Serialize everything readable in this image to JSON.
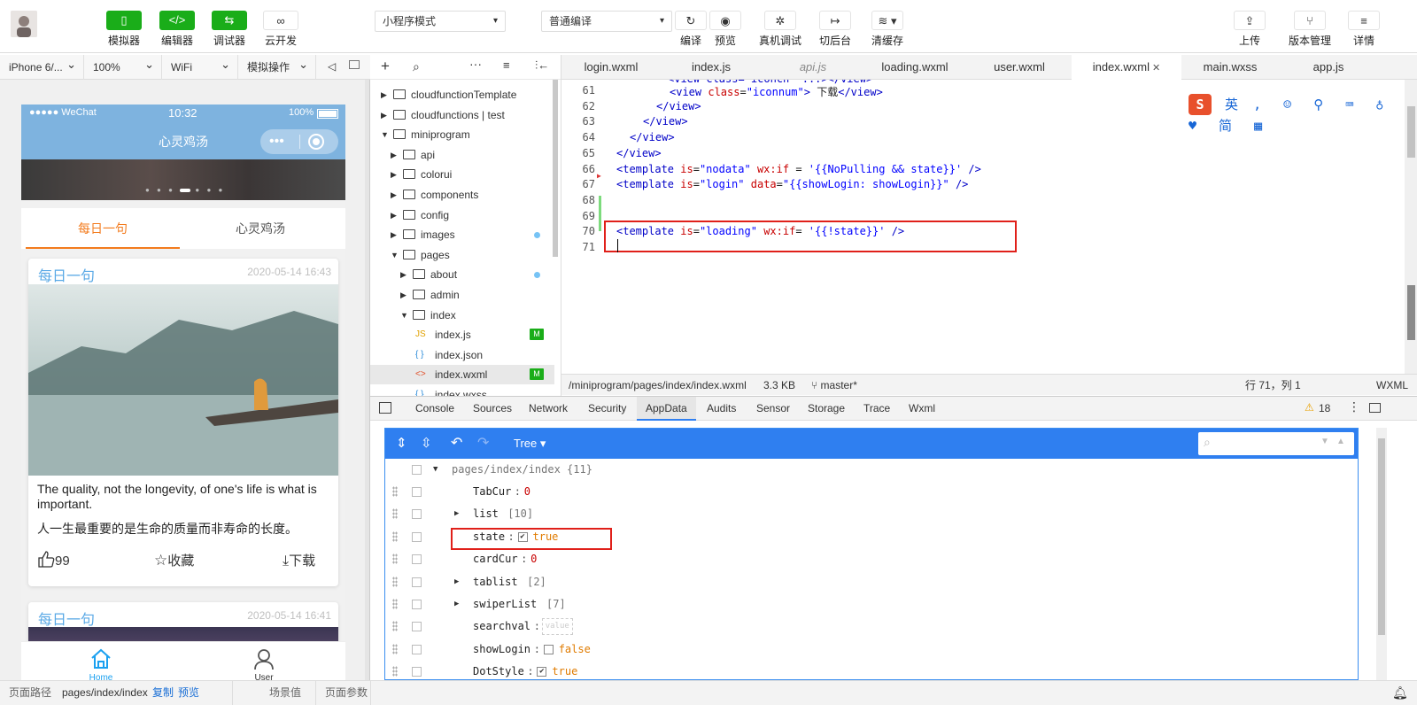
{
  "toolbar": {
    "left_buttons": [
      {
        "label": "模拟器",
        "icon": "phone-icon"
      },
      {
        "label": "编辑器",
        "icon": "code-icon"
      },
      {
        "label": "调试器",
        "icon": "debug-icon"
      },
      {
        "label": "云开发",
        "icon": "cloud-link-icon"
      }
    ],
    "mode_select": "小程序模式",
    "compile_select": "普通编译",
    "mid_buttons": [
      {
        "label": "编译",
        "icon": "refresh-icon"
      },
      {
        "label": "预览",
        "icon": "eye-icon"
      },
      {
        "label": "真机调试",
        "icon": "bug-icon"
      },
      {
        "label": "切后台",
        "icon": "switch-icon"
      },
      {
        "label": "清缓存",
        "icon": "layers-icon"
      }
    ],
    "right_buttons": [
      {
        "label": "上传",
        "icon": "upload-icon"
      },
      {
        "label": "版本管理",
        "icon": "branch-icon"
      },
      {
        "label": "详情",
        "icon": "menu-icon"
      }
    ]
  },
  "simulator_bar": {
    "device": "iPhone 6/...",
    "zoom": "100%",
    "network": "WiFi",
    "operation": "模拟操作"
  },
  "phone": {
    "carrier": "●●●●● WeChat",
    "time": "10:32",
    "battery": "100%",
    "nav_title": "心灵鸡汤",
    "tabs": [
      "每日一句",
      "心灵鸡汤"
    ],
    "cards": [
      {
        "title": "每日一句",
        "date": "2020-05-14 16:43",
        "english": "The quality, not the longevity, of one's life is what is important.",
        "chinese": "人一生最重要的是生命的质量而非寿命的长度。",
        "likes": "99",
        "collect": "收藏",
        "download": "下载"
      },
      {
        "title": "每日一句",
        "date": "2020-05-14 16:41"
      }
    ],
    "tabbar": [
      {
        "label": "Home",
        "active": true
      },
      {
        "label": "User",
        "active": false
      }
    ],
    "accent_color": "#7eb3df",
    "tab_active_color": "#f37b1d"
  },
  "explorer": {
    "items": [
      {
        "label": "cloudfunctionTemplate",
        "depth": 0,
        "type": "folder",
        "open": false
      },
      {
        "label": "cloudfunctions | test",
        "depth": 0,
        "type": "cloud-folder",
        "open": false
      },
      {
        "label": "miniprogram",
        "depth": 0,
        "type": "folder",
        "open": true
      },
      {
        "label": "api",
        "depth": 1,
        "type": "folder",
        "open": false
      },
      {
        "label": "colorui",
        "depth": 1,
        "type": "folder",
        "open": false
      },
      {
        "label": "components",
        "depth": 1,
        "type": "folder",
        "open": false
      },
      {
        "label": "config",
        "depth": 1,
        "type": "folder",
        "open": false
      },
      {
        "label": "images",
        "depth": 1,
        "type": "folder",
        "open": false,
        "dot": true
      },
      {
        "label": "pages",
        "depth": 1,
        "type": "folder",
        "open": true
      },
      {
        "label": "about",
        "depth": 2,
        "type": "folder",
        "open": false,
        "dot": true
      },
      {
        "label": "admin",
        "depth": 2,
        "type": "folder",
        "open": false
      },
      {
        "label": "index",
        "depth": 2,
        "type": "folder",
        "open": true
      },
      {
        "label": "index.js",
        "depth": 3,
        "type": "js",
        "badge": "M"
      },
      {
        "label": "index.json",
        "depth": 3,
        "type": "json"
      },
      {
        "label": "index.wxml",
        "depth": 3,
        "type": "wxml",
        "badge": "M",
        "active": true
      },
      {
        "label": "index.wxss",
        "depth": 3,
        "type": "wxss"
      }
    ]
  },
  "editor": {
    "tabs": [
      {
        "label": "login.wxml"
      },
      {
        "label": "index.js"
      },
      {
        "label": "api.js",
        "italic": true
      },
      {
        "label": "loading.wxml"
      },
      {
        "label": "user.wxml"
      },
      {
        "label": "index.wxml",
        "active": true
      },
      {
        "label": "main.wxss"
      },
      {
        "label": "app.js"
      }
    ],
    "lines": [
      {
        "n": "61",
        "indent": 8,
        "parts": [
          [
            "tg",
            "<view "
          ],
          [
            "at",
            "class"
          ],
          [
            "tx",
            "="
          ],
          [
            "st",
            "\"iconnum\""
          ],
          [
            "tg",
            ">"
          ],
          [
            "tx",
            " 下载"
          ],
          [
            "tg",
            "</view>"
          ]
        ]
      },
      {
        "n": "62",
        "indent": 6,
        "parts": [
          [
            "tg",
            "</view>"
          ]
        ]
      },
      {
        "n": "63",
        "indent": 4,
        "parts": [
          [
            "tg",
            "</view>"
          ]
        ]
      },
      {
        "n": "64",
        "indent": 2,
        "parts": [
          [
            "tg",
            "</view>"
          ]
        ]
      },
      {
        "n": "65",
        "indent": 0,
        "parts": [
          [
            "tg",
            "</view>"
          ]
        ]
      },
      {
        "n": "66",
        "indent": 0,
        "parts": [
          [
            "tg",
            "<template "
          ],
          [
            "at",
            "is"
          ],
          [
            "tx",
            "="
          ],
          [
            "st",
            "\"nodata\""
          ],
          [
            "at",
            " wx:if"
          ],
          [
            "tx",
            " = "
          ],
          [
            "st",
            "'{{NoPulling && state}}'"
          ],
          [
            "tg",
            " />"
          ]
        ]
      },
      {
        "n": "67",
        "indent": 0,
        "parts": [
          [
            "tg",
            "<template "
          ],
          [
            "at",
            "is"
          ],
          [
            "tx",
            "="
          ],
          [
            "st",
            "\"login\""
          ],
          [
            "at",
            " data"
          ],
          [
            "tx",
            "="
          ],
          [
            "st",
            "\"{{showLogin: showLogin}}\""
          ],
          [
            "tg",
            " />"
          ]
        ]
      },
      {
        "n": "68",
        "indent": 0,
        "parts": []
      },
      {
        "n": "69",
        "indent": 0,
        "parts": []
      },
      {
        "n": "70",
        "indent": 0,
        "parts": [
          [
            "tg",
            "<template "
          ],
          [
            "at",
            "is"
          ],
          [
            "tx",
            "="
          ],
          [
            "st",
            "\"loading\""
          ],
          [
            "at",
            " wx:if"
          ],
          [
            "tx",
            "= "
          ],
          [
            "st",
            "'{{!state}}'"
          ],
          [
            "tg",
            " />"
          ]
        ]
      },
      {
        "n": "71",
        "indent": 0,
        "parts": []
      }
    ],
    "status_path": "/miniprogram/pages/index/index.wxml",
    "status_size": "3.3 KB",
    "status_branch": "master*",
    "status_pos": "行 71，列 1",
    "status_lang": "WXML"
  },
  "devtools": {
    "tabs": [
      "Console",
      "Sources",
      "Network",
      "Security",
      "AppData",
      "Audits",
      "Sensor",
      "Storage",
      "Trace",
      "Wxml"
    ],
    "active_tab": "AppData",
    "warning_count": "18",
    "view_mode": "Tree",
    "root": "pages/index/index {11}",
    "rows": [
      {
        "key": "TabCur",
        "value": "0",
        "kind": "num"
      },
      {
        "key": "list",
        "value": "[10]",
        "kind": "expand"
      },
      {
        "key": "state",
        "value": "true",
        "kind": "bool-checked"
      },
      {
        "key": "cardCur",
        "value": "0",
        "kind": "num"
      },
      {
        "key": "tablist",
        "value": "[2]",
        "kind": "expand"
      },
      {
        "key": "swiperList",
        "value": "[7]",
        "kind": "expand"
      },
      {
        "key": "searchval",
        "value": "value",
        "kind": "input"
      },
      {
        "key": "showLogin",
        "value": "false",
        "kind": "bool-unchecked"
      },
      {
        "key": "DotStyle",
        "value": "true",
        "kind": "bool-checked"
      }
    ]
  },
  "bottom_bar": {
    "path_label": "页面路径",
    "path": "pages/index/index",
    "copy": "复制",
    "preview": "预览",
    "scene": "场景值",
    "params": "页面参数"
  },
  "ime": {
    "label": "英"
  }
}
